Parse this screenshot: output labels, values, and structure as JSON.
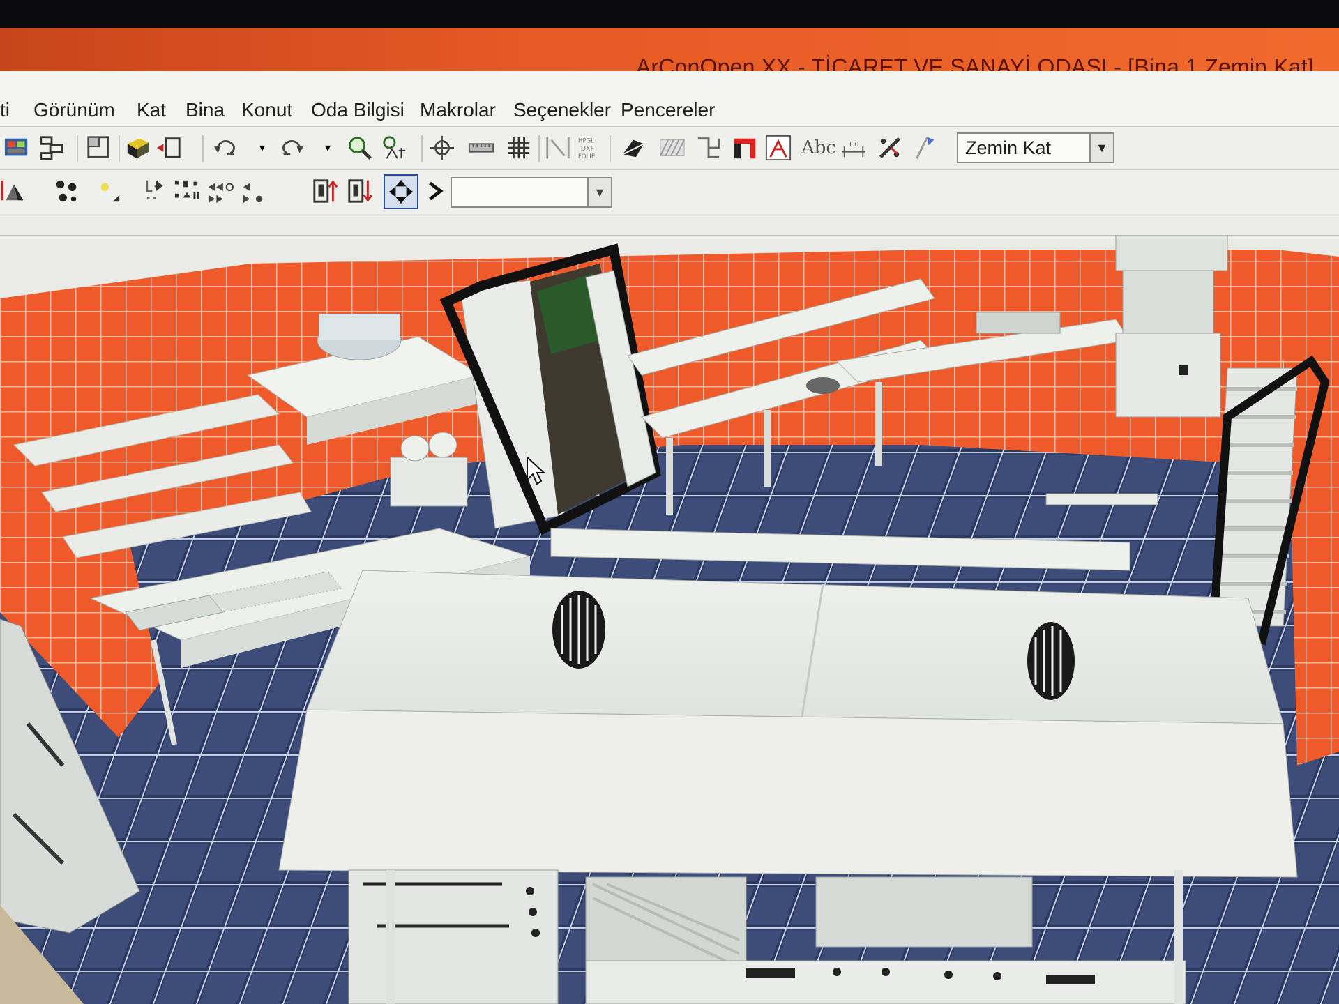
{
  "window": {
    "title": "ArConOpen XX - TİCARET VE SANAYİ ODASI - [Bina 1,Zemin Kat]"
  },
  "menu": {
    "items": [
      "ti",
      "Görünüm",
      "Kat",
      "Bina",
      "Konut",
      "Oda Bilgisi",
      "Makrolar",
      "Seçenekler",
      "Pencereler"
    ]
  },
  "toolbar": {
    "text_tool_label": "Abc",
    "plot_label": "HPGL DXF FOLIE",
    "floor_select": {
      "value": "Zemin Kat"
    },
    "layer_select": {
      "value": ""
    }
  },
  "icons": {
    "menu_arrow": "▾",
    "dropdown_arrow": "▼"
  },
  "colors": {
    "titlebar": "#e65a25",
    "wall_tile": "#ee5a2a",
    "floor_tile": "#2c3a62",
    "furniture": "#e9ece7"
  }
}
